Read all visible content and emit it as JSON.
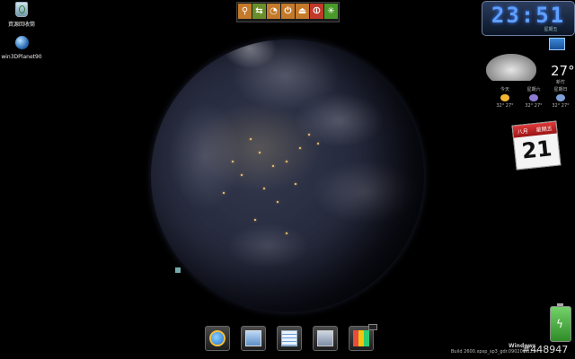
{
  "desktop": {
    "icons": [
      {
        "label": "資源回收筒",
        "icon": "recycle-bin-icon"
      },
      {
        "label": "win3DPlanet90",
        "icon": "globe-icon"
      }
    ]
  },
  "toolbar": {
    "buttons": [
      {
        "icon": "search-icon",
        "glyph": "⚲",
        "color": "#c47a2a"
      },
      {
        "icon": "swap-icon",
        "glyph": "⇆",
        "color": "#6a8f2a"
      },
      {
        "icon": "timer-icon",
        "glyph": "◔",
        "color": "#c47a2a"
      },
      {
        "icon": "power-icon",
        "glyph": "⏻",
        "color": "#c47a2a"
      },
      {
        "icon": "eject-icon",
        "glyph": "⏏",
        "color": "#c47a2a"
      },
      {
        "icon": "exit-icon",
        "glyph": "⏼",
        "color": "#c0392b"
      },
      {
        "icon": "settings-icon",
        "glyph": "✳",
        "color": "#4a9a2a"
      }
    ]
  },
  "clock": {
    "time": "23:51",
    "sub": "星期五"
  },
  "weather": {
    "temperature": "27°",
    "city": "新竹",
    "forecast": [
      {
        "day": "今天",
        "temps": "32° 27°",
        "icon": "sunny-icon"
      },
      {
        "day": "星期六",
        "temps": "32° 27°",
        "icon": "thunderstorm-icon"
      },
      {
        "day": "星期日",
        "temps": "32° 27°",
        "icon": "rain-icon"
      }
    ]
  },
  "calendar": {
    "month": "八月",
    "weekday": "星期五",
    "day": "21"
  },
  "dock": {
    "items": [
      {
        "icon": "internet-explorer-icon"
      },
      {
        "icon": "my-computer-icon"
      },
      {
        "icon": "notepad-icon"
      },
      {
        "icon": "calculator-icon"
      },
      {
        "icon": "paint-icon"
      }
    ]
  },
  "status": {
    "build": "Build 2600.xpsp_sp3_gdr.090206-1234",
    "os_label": "Windows",
    "image_id": "#448947"
  },
  "colors": {
    "clock_digits": "#5fa0ff",
    "battery": "#4fb043",
    "calendar_header": "#c42626"
  }
}
